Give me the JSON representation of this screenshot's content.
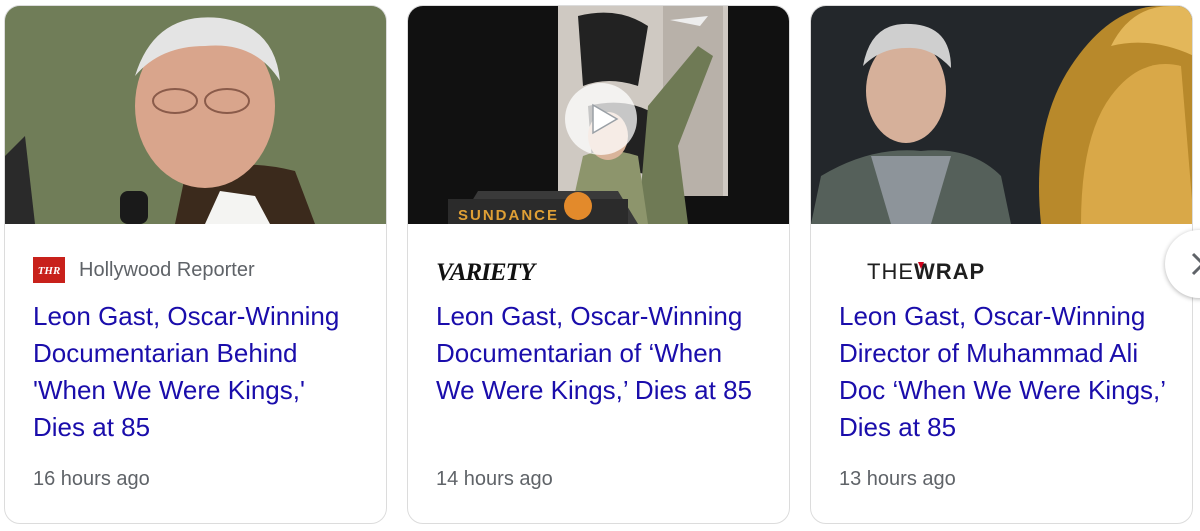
{
  "cards": [
    {
      "source_logo": "THR",
      "source_name": "Hollywood Reporter",
      "headline": "Leon Gast, Oscar-Winning Documentarian Behind 'When We Were Kings,' Dies at 85",
      "time": "16 hours ago"
    },
    {
      "source_logo": "VARIETY",
      "headline": "Leon Gast, Oscar-Winning Documentarian of ‘When We Were Kings,’ Dies at 85",
      "time": "14 hours ago",
      "backdrop_text": "SUNDANCE"
    },
    {
      "source_logo_parts": [
        "THE",
        "WRAP"
      ],
      "headline": "Leon Gast, Oscar-Winning Director of Muhammad Ali Doc ‘When We Were Kings,’ Dies at 85",
      "time": "13 hours ago"
    }
  ],
  "icons": {
    "play": "play-icon",
    "next": "chevron-right-icon"
  },
  "colors": {
    "headline": "#1a0dab",
    "meta": "#5f6368",
    "thr_red": "#c8211b",
    "wrap_red": "#d0021b"
  }
}
